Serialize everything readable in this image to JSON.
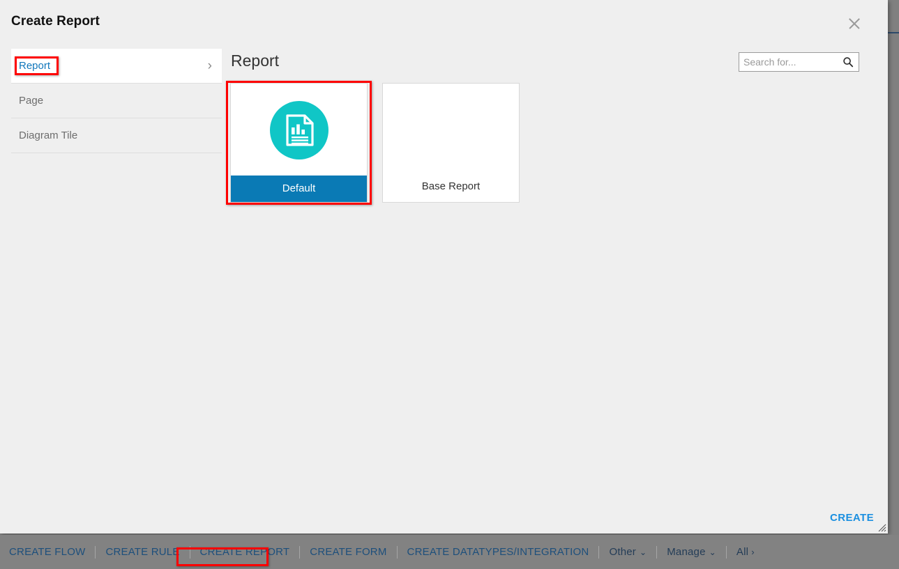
{
  "dialog": {
    "title": "Create Report",
    "close_icon": "close-icon",
    "create_label": "CREATE"
  },
  "nav": {
    "items": [
      {
        "label": "Report",
        "selected": true,
        "chevron": "›"
      },
      {
        "label": "Page",
        "selected": false
      },
      {
        "label": "Diagram Tile",
        "selected": false
      }
    ]
  },
  "main": {
    "heading": "Report",
    "search": {
      "value": "",
      "placeholder": "Search for...",
      "icon": "search-icon"
    },
    "cards": [
      {
        "label": "Default",
        "selected": true,
        "icon": "report-document-chart-icon",
        "icon_color": "#10c6c6",
        "footer_color": "#0a7ab5"
      },
      {
        "label": "Base Report",
        "selected": false,
        "icon": "none"
      }
    ]
  },
  "bottombar": {
    "items": [
      {
        "label": "CREATE FLOW",
        "style": "link"
      },
      {
        "label": "CREATE RULE",
        "style": "link"
      },
      {
        "label": "CREATE REPORT",
        "style": "link",
        "highlighted": true
      },
      {
        "label": "CREATE FORM",
        "style": "link"
      },
      {
        "label": "CREATE DATATYPES/INTEGRATION",
        "style": "link"
      },
      {
        "label": "Other",
        "style": "menu",
        "caret": "⌄"
      },
      {
        "label": "Manage",
        "style": "menu",
        "caret": "⌄"
      },
      {
        "label": "All",
        "style": "menu",
        "chevron": "›"
      }
    ]
  },
  "annotations": {
    "accent_color": "#fe0000",
    "boxes": [
      "report-nav-item",
      "default-card",
      "create-report-bottom-item"
    ]
  }
}
